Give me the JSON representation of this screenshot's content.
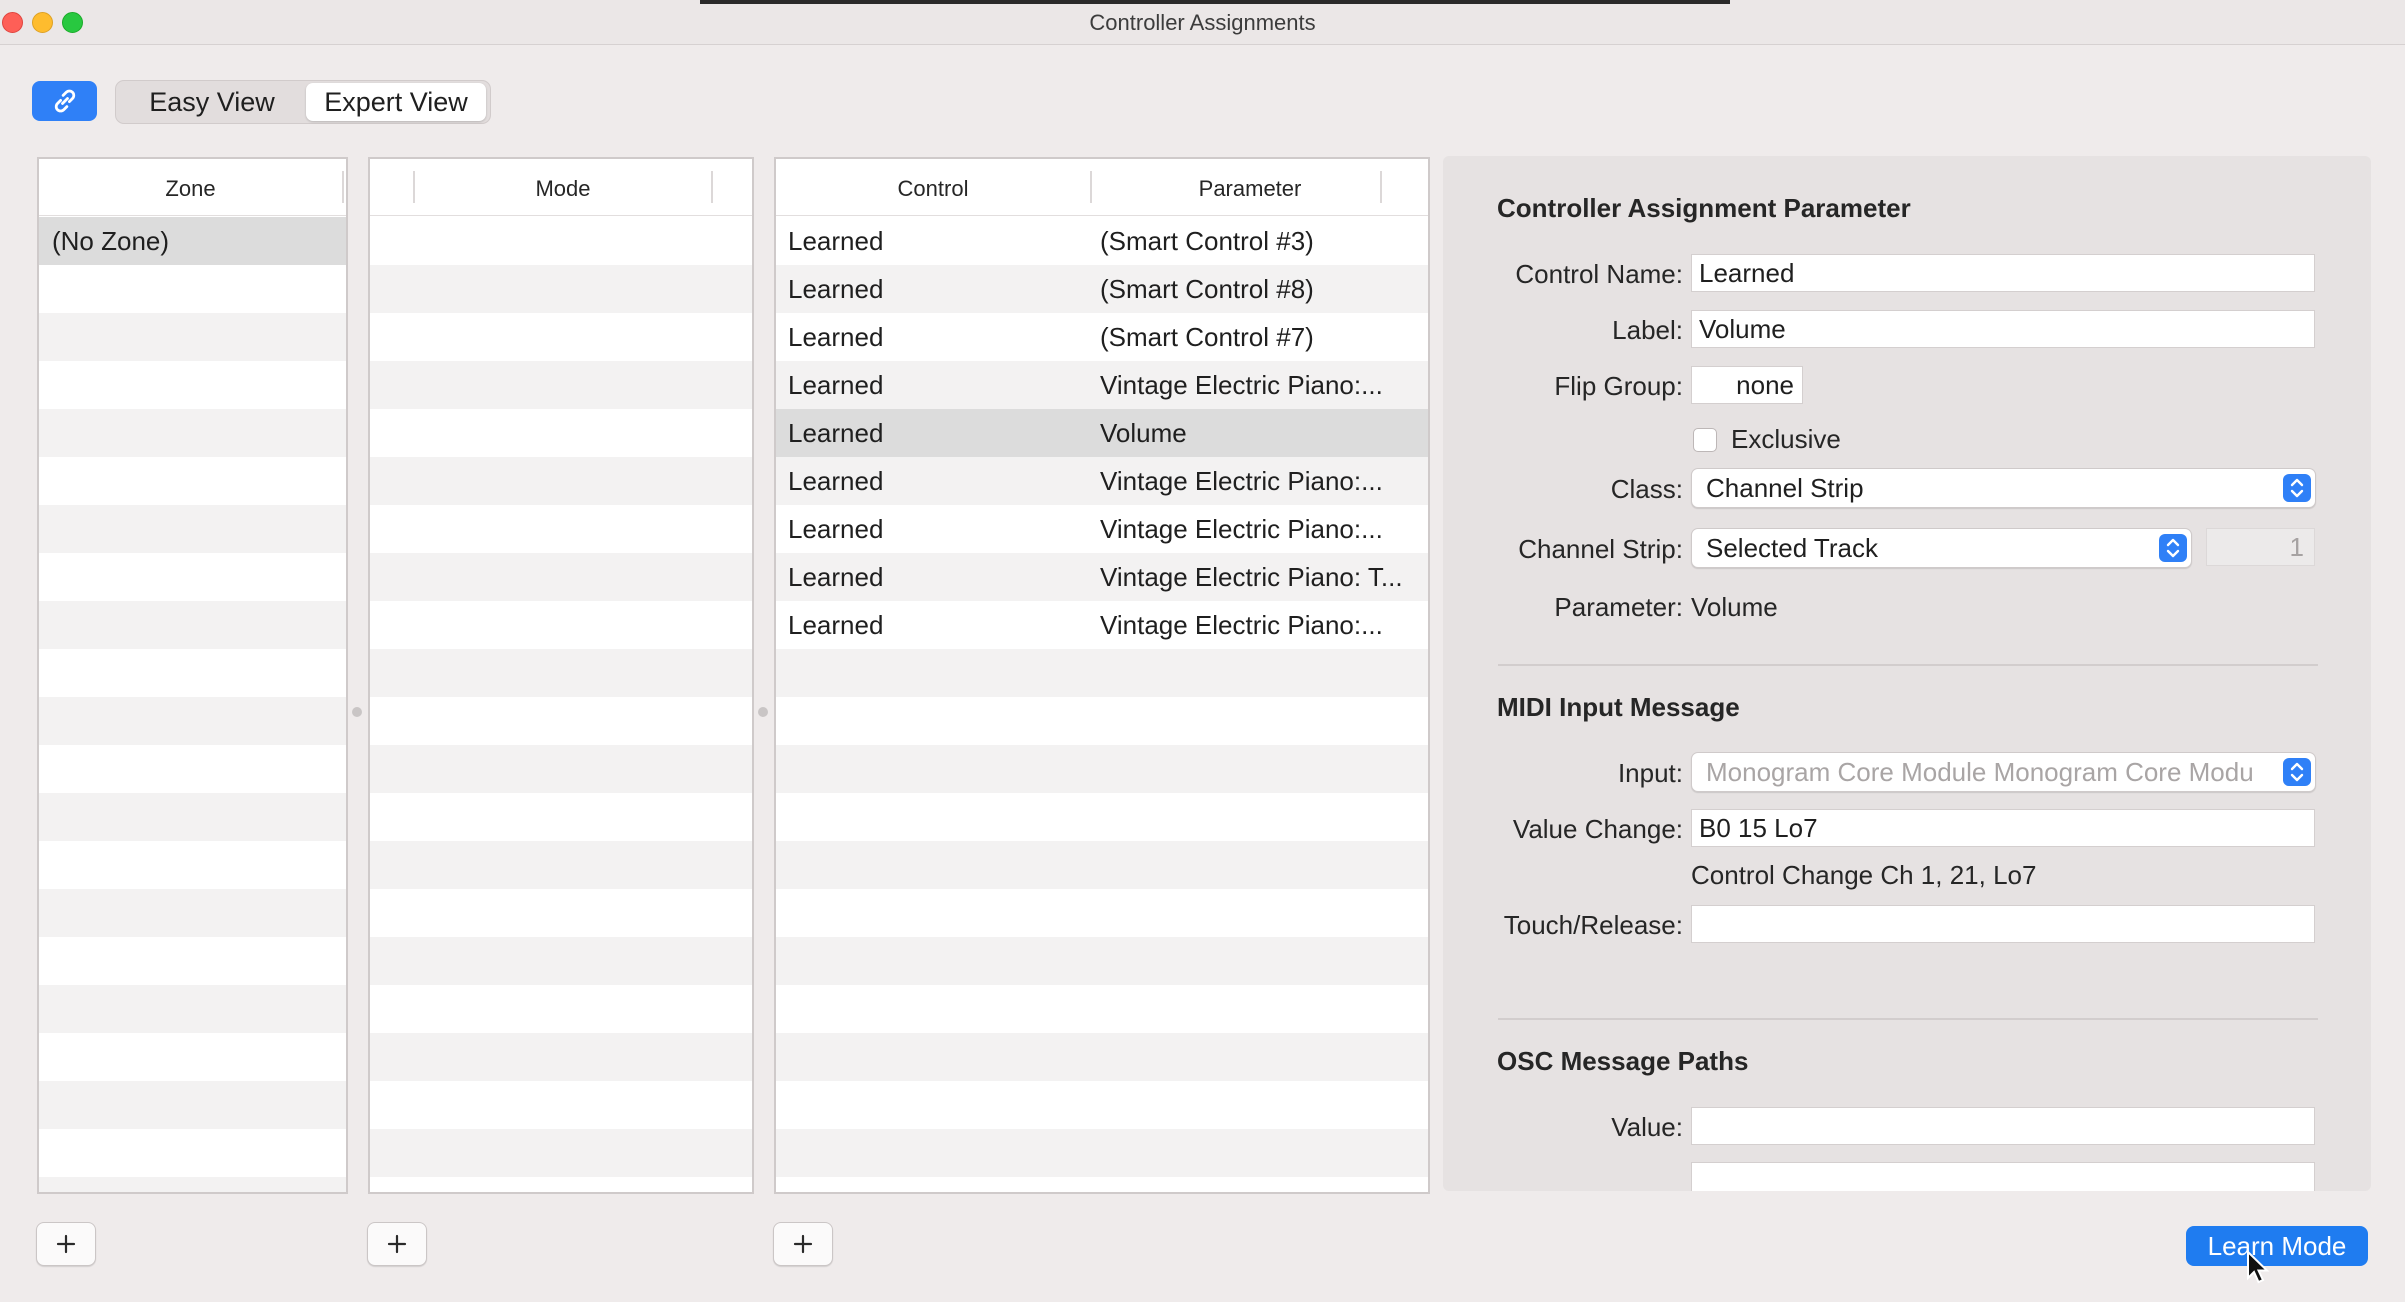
{
  "window": {
    "title": "Controller Assignments"
  },
  "toolbar": {
    "link_icon": "link-icon",
    "view_options": [
      "Easy View",
      "Expert View"
    ],
    "selected_view": "Expert View"
  },
  "zone_table": {
    "header": "Zone",
    "rows": [
      "(No Zone)"
    ],
    "selected": "(No Zone)"
  },
  "mode_table": {
    "header": "Mode",
    "rows": []
  },
  "assignments_table": {
    "headers": {
      "control": "Control",
      "parameter": "Parameter"
    },
    "rows": [
      {
        "control": "Learned",
        "parameter": "(Smart Control #3)"
      },
      {
        "control": "Learned",
        "parameter": "(Smart Control #8)"
      },
      {
        "control": "Learned",
        "parameter": "(Smart Control #7)"
      },
      {
        "control": "Learned",
        "parameter": "Vintage Electric Piano:..."
      },
      {
        "control": "Learned",
        "parameter": "Volume"
      },
      {
        "control": "Learned",
        "parameter": "Vintage Electric Piano:..."
      },
      {
        "control": "Learned",
        "parameter": "Vintage Electric Piano:..."
      },
      {
        "control": "Learned",
        "parameter": "Vintage Electric Piano: T..."
      },
      {
        "control": "Learned",
        "parameter": "Vintage Electric Piano:..."
      }
    ],
    "selected_row": "Volume"
  },
  "add_buttons": {
    "label": "+"
  },
  "inspector": {
    "assignment": {
      "title": "Controller Assignment Parameter",
      "control_name_label": "Control Name:",
      "control_name_value": "Learned",
      "label_label": "Label:",
      "label_value": "Volume",
      "flip_group_label": "Flip Group:",
      "flip_group_value": "none",
      "exclusive_label": "Exclusive",
      "exclusive_checked": false,
      "class_label": "Class:",
      "class_value": "Channel Strip",
      "channel_strip_label": "Channel Strip:",
      "channel_strip_value": "Selected Track",
      "channel_strip_number": "1",
      "parameter_label": "Parameter:",
      "parameter_value": "Volume"
    },
    "midi": {
      "title": "MIDI Input Message",
      "input_label": "Input:",
      "input_value": "Monogram Core Module Monogram Core Modu",
      "value_change_label": "Value Change:",
      "value_change_value": "B0 15 Lo7",
      "value_change_description": "Control Change Ch 1, 21, Lo7",
      "touch_release_label": "Touch/Release:",
      "touch_release_value": ""
    },
    "osc": {
      "title": "OSC Message Paths",
      "value_label": "Value:",
      "value_value": ""
    }
  },
  "learn_mode": {
    "label": "Learn Mode"
  },
  "colors": {
    "accent": "#2f80f7",
    "window_bg": "#efebeb",
    "inspector_bg": "#e6e2e2",
    "selected_row": "#dcdcdc"
  }
}
